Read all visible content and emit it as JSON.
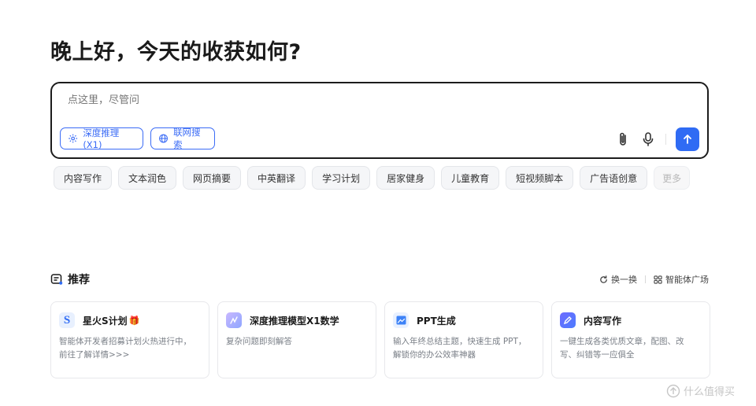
{
  "greeting": "晚上好，今天的收获如何?",
  "input": {
    "placeholder": "点这里，尽管问",
    "reason_button": "深度推理(X1)",
    "search_button": "联网搜索"
  },
  "quick_chips": [
    "内容写作",
    "文本润色",
    "网页摘要",
    "中英翻译",
    "学习计划",
    "居家健身",
    "儿童教育",
    "短视频脚本",
    "广告语创意",
    "更多"
  ],
  "recommend": {
    "title": "推荐",
    "refresh": "换一换",
    "agent_plaza": "智能体广场",
    "cards": [
      {
        "title": "星火S计划",
        "desc": "智能体开发者招募计划火热进行中，前往了解详情>>>",
        "icon": "s-logo-icon",
        "badge": "🎁"
      },
      {
        "title": "深度推理模型X1数学",
        "desc": "复杂问题即刻解答",
        "icon": "math-model-icon"
      },
      {
        "title": "PPT生成",
        "desc": "输入年终总结主题，快速生成 PPT，解锁你的办公效率神器",
        "icon": "ppt-icon"
      },
      {
        "title": "内容写作",
        "desc": "一键生成各类优质文章，配图、改写、纠错等一应俱全",
        "icon": "writing-icon"
      }
    ]
  },
  "watermark": "什么值得买",
  "colors": {
    "accent": "#2f6bf4",
    "border_dark": "#1c1c1c",
    "chip_bg": "#f5f6f8"
  }
}
